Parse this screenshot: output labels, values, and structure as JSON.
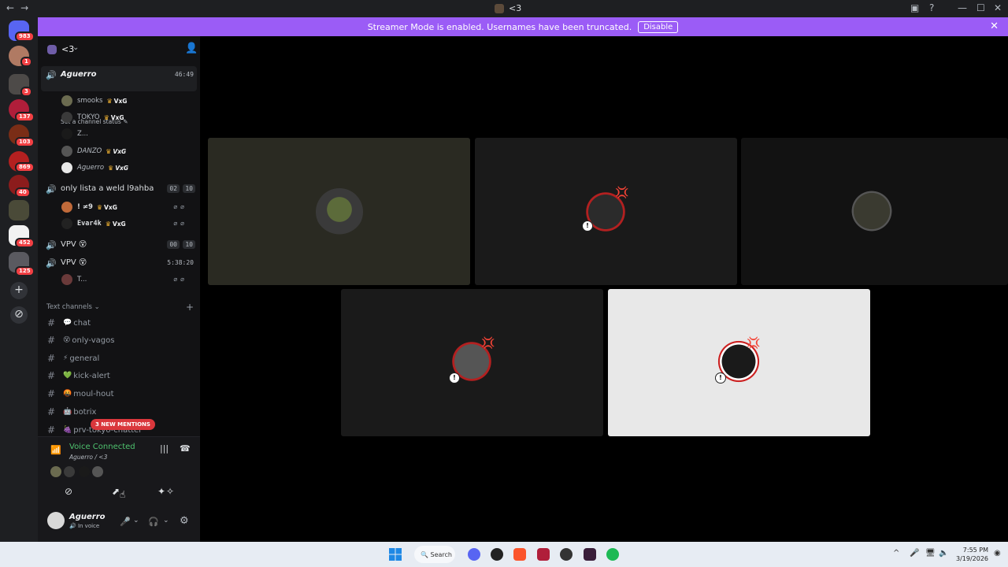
{
  "window": {
    "title": "<3",
    "nav_back": "←",
    "nav_forward": "→",
    "inbox_icon": "inbox-icon",
    "help_icon": "help-icon",
    "min": "—",
    "max": "☐",
    "close": "✕"
  },
  "banner": {
    "text": "Streamer Mode is enabled. Usernames have been truncated.",
    "disable_label": "Disable",
    "close": "✕"
  },
  "rail": {
    "badges": [
      "983",
      "1",
      "3",
      "137",
      "103",
      "869",
      "40",
      "452",
      "125"
    ],
    "add": "+",
    "discover": "⊘"
  },
  "server": {
    "name": "<3",
    "chevron": "⌄",
    "add_member_icon": "👤"
  },
  "voice_channels": [
    {
      "name": "Aguerro",
      "time": "46:49",
      "status": "Set a channel status",
      "members": [
        {
          "name": "smooks",
          "tag": "VxG"
        },
        {
          "name": "TOKYO",
          "tag": "VxG"
        },
        {
          "name": "Z...",
          "tag": ""
        },
        {
          "name": "DANZO",
          "tag": "VxG"
        },
        {
          "name": "Aguerro",
          "tag": "VxG"
        }
      ]
    },
    {
      "name": "only lista a weld l9ahba",
      "count_a": "02",
      "count_b": "10",
      "members": [
        {
          "name": "! ≠9",
          "tag": "VxG"
        },
        {
          "name": "Evar4k",
          "tag": "VxG"
        }
      ]
    },
    {
      "name": "VPV 😵",
      "count_a": "00",
      "count_b": "10",
      "members": []
    },
    {
      "name": "VPV 😵",
      "time": "5:38:20",
      "members": [
        {
          "name": "T...",
          "tag": ""
        }
      ]
    }
  ],
  "text_category": {
    "label": "Text channels",
    "chevron": "⌄",
    "add": "+"
  },
  "text_channels": [
    {
      "emoji": "💬",
      "name": "chat"
    },
    {
      "emoji": "😵",
      "name": "only-vagos"
    },
    {
      "emoji": "⚡",
      "name": "general"
    },
    {
      "emoji": "💚",
      "name": "kick-alert"
    },
    {
      "emoji": "🤬",
      "name": "moul-hout"
    },
    {
      "emoji": "🤖",
      "name": "botrix"
    },
    {
      "emoji": "🍇",
      "name": "prv-tokyo-chatter"
    }
  ],
  "mentions_pill": "3 NEW MENTIONS",
  "voice_panel": {
    "title": "Voice Connected",
    "subtitle": "Aguerro / <3",
    "signal_icon": "((·",
    "wave_icon": "|||",
    "hangup_icon": "☎",
    "actions": [
      "⊘",
      "⬈",
      "✦",
      "✧"
    ]
  },
  "user_panel": {
    "name": "Aguerro",
    "status": "In voice",
    "mic": "🎤",
    "headset": "🎧",
    "settings": "⚙",
    "caret": "⌄"
  },
  "taskbar": {
    "search": "Search",
    "time": "7:55 PM",
    "date": "3/19/2026",
    "tray_up": "^"
  }
}
